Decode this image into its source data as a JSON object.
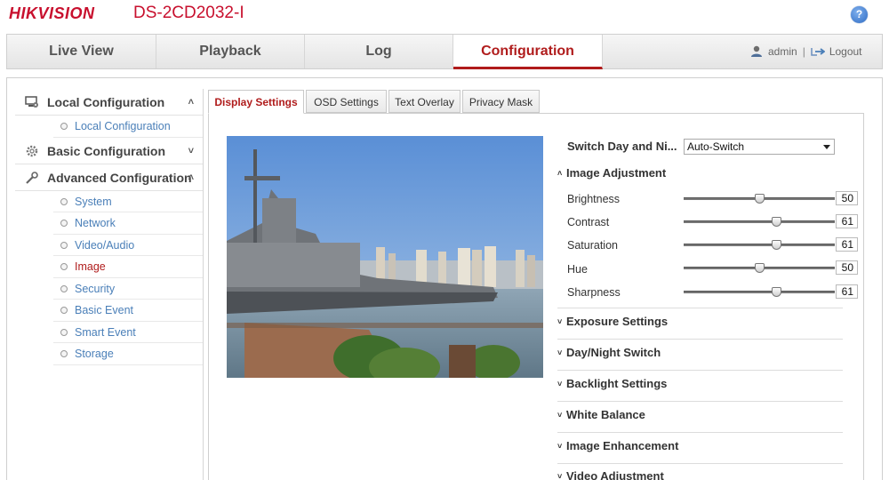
{
  "header": {
    "brand": "HIKVISION",
    "model": "DS-2CD2032-I",
    "help_icon": "question-circle-icon",
    "help_glyph": "?"
  },
  "main_tabs": [
    {
      "label": "Live View"
    },
    {
      "label": "Playback"
    },
    {
      "label": "Log"
    },
    {
      "label": "Configuration",
      "active": true
    }
  ],
  "user": {
    "name": "admin",
    "separator": "|",
    "logout_label": "Logout"
  },
  "sidebar": {
    "local": {
      "label": "Local Configuration",
      "chevron": "^",
      "items": [
        {
          "label": "Local Configuration"
        }
      ]
    },
    "basic": {
      "label": "Basic Configuration",
      "chevron": "v"
    },
    "advanced": {
      "label": "Advanced Configuration",
      "chevron": "^",
      "items": [
        {
          "label": "System"
        },
        {
          "label": "Network"
        },
        {
          "label": "Video/Audio"
        },
        {
          "label": "Image",
          "active": true
        },
        {
          "label": "Security"
        },
        {
          "label": "Basic Event"
        },
        {
          "label": "Smart Event"
        },
        {
          "label": "Storage"
        }
      ]
    }
  },
  "sub_tabs": [
    {
      "label": "Display Settings",
      "active": true
    },
    {
      "label": "OSD Settings"
    },
    {
      "label": "Text Overlay"
    },
    {
      "label": "Privacy Mask"
    }
  ],
  "settings": {
    "day_night_label": "Switch Day and Ni...",
    "day_night_value": "Auto-Switch",
    "image_adjustment": {
      "title": "Image Adjustment",
      "caret": "^",
      "sliders": [
        {
          "label": "Brightness",
          "value": "50",
          "level": 50
        },
        {
          "label": "Contrast",
          "value": "61",
          "level": 61
        },
        {
          "label": "Saturation",
          "value": "61",
          "level": 61
        },
        {
          "label": "Hue",
          "value": "50",
          "level": 50
        },
        {
          "label": "Sharpness",
          "value": "61",
          "level": 61
        }
      ]
    },
    "sections": [
      {
        "title": "Exposure Settings",
        "caret": "v"
      },
      {
        "title": "Day/Night Switch",
        "caret": "v"
      },
      {
        "title": "Backlight Settings",
        "caret": "v"
      },
      {
        "title": "White Balance",
        "caret": "v"
      },
      {
        "title": "Image Enhancement",
        "caret": "v"
      },
      {
        "title": "Video Adjustment",
        "caret": "v"
      }
    ]
  },
  "colors": {
    "brand_red": "#c8102e",
    "active_red": "#b01c1c",
    "link_blue": "#4a7fb8"
  }
}
